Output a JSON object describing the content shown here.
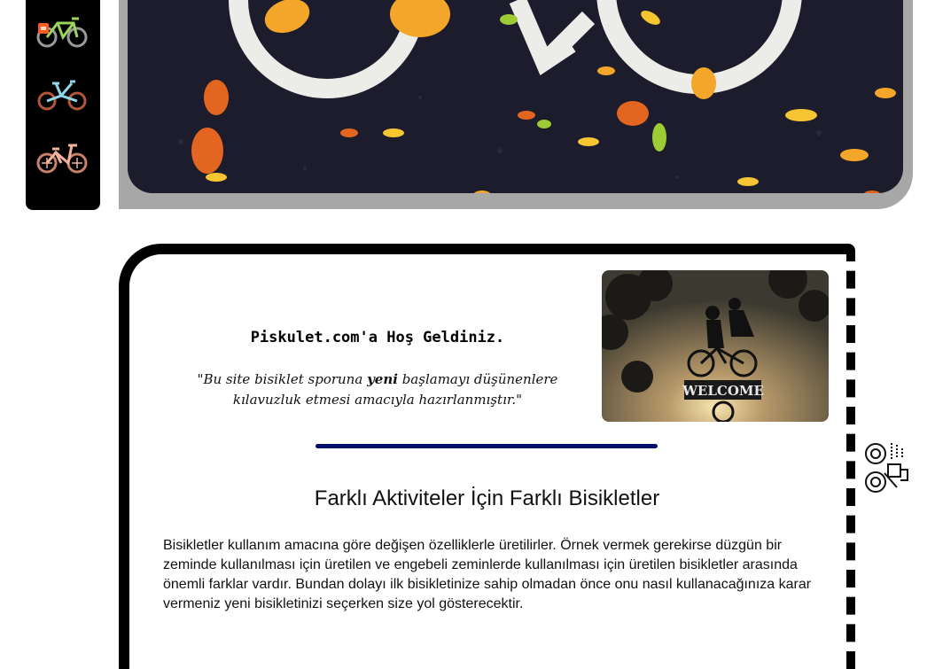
{
  "sidebar": {
    "items": [
      {
        "name": "cargo-bike-icon",
        "frame": "#9bd65b",
        "accent": "#ff5a1f",
        "wheel": "#9a9a9a"
      },
      {
        "name": "folding-bike-icon",
        "frame": "#8fd6e8",
        "accent": "#111111",
        "wheel": "#b0573a"
      },
      {
        "name": "city-bike-icon",
        "frame": "#f3b29c",
        "accent": "#f3b29c",
        "wheel": "#c7806a"
      }
    ]
  },
  "hero": {
    "icon": "bicycle-road-marking",
    "background": "#1c1c2c",
    "leaf_colors": [
      "#f4a62a",
      "#f7c531",
      "#e2661f",
      "#9ccb34"
    ]
  },
  "welcome": {
    "title": "Piskulet.com'a Hoş Geldiniz.",
    "quote_before": "\"Bu site bisiklet sporuna ",
    "quote_bold": "yeni",
    "quote_after": " başlamayı düşünenlere kılavuzluk etmesi amacıyla hazırlanmıştır.\"",
    "photo": {
      "sign_text": "WELCOME"
    }
  },
  "divider": {
    "color": "#00106a"
  },
  "section": {
    "title": "Farklı Aktiviteler İçin Farklı Bisikletler",
    "text": "Bisikletler kullanım amacına göre değişen özelliklerle üretilirler. Örnek vermek gerekirse düzgün bir zeminde kullanılması için üretilen ve engebeli zeminlerde kullanılması için üretilen bisikletler arasında önemli farklar vardır. Bundan dolayı ilk bisikletinize sahip olmadan önce onu nasıl kullanacağınıza karar vermeniz yeni bisikletinizi seçerken size yol gösterecektir."
  },
  "float_icon": {
    "name": "bike-parts-icon"
  }
}
